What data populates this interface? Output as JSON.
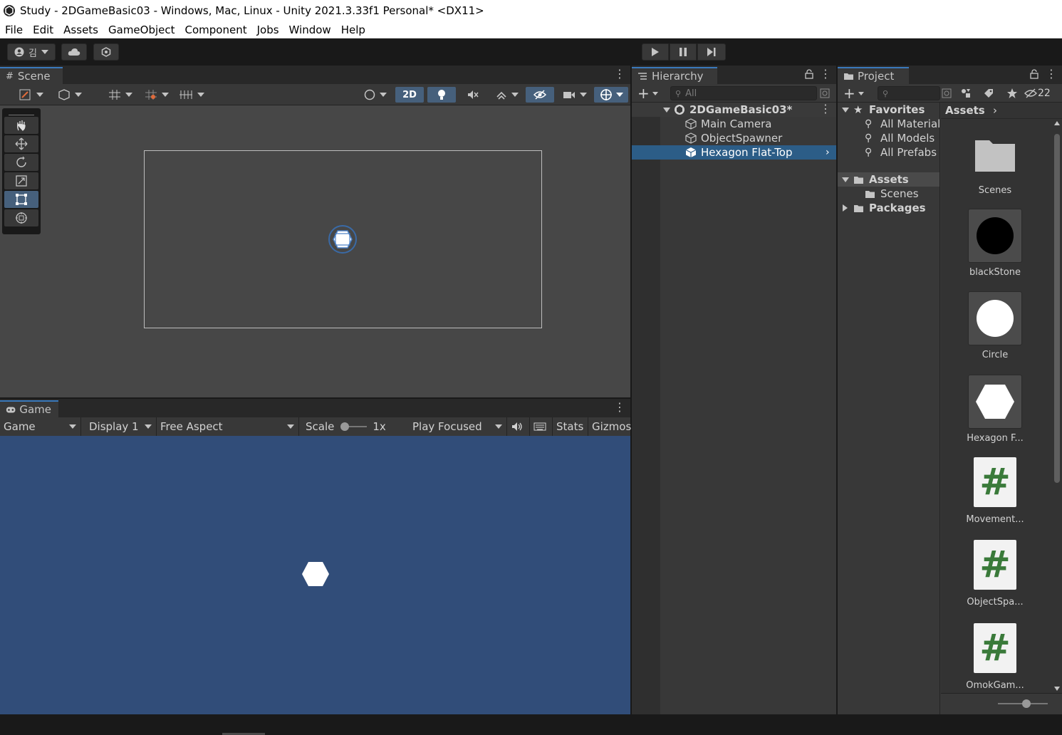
{
  "window": {
    "title": "Study - 2DGameBasic03 - Windows, Mac, Linux - Unity 2021.3.33f1 Personal* <DX11>"
  },
  "menu": [
    "File",
    "Edit",
    "Assets",
    "GameObject",
    "Component",
    "Jobs",
    "Window",
    "Help"
  ],
  "toolbar": {
    "account_label": "김"
  },
  "scene": {
    "tab_label": "Scene",
    "mode_2d_label": "2D"
  },
  "game": {
    "tab_label": "Game",
    "view_select": "Game",
    "display_select": "Display 1",
    "aspect_select": "Free Aspect",
    "scale_label": "Scale",
    "scale_value": "1x",
    "play_mode_select": "Play Focused",
    "stats_label": "Stats",
    "gizmos_label": "Gizmos"
  },
  "hierarchy": {
    "tab_label": "Hierarchy",
    "search_placeholder": "All",
    "scene_name": "2DGameBasic03*",
    "items": [
      "Main Camera",
      "ObjectSpawner",
      "Hexagon Flat-Top"
    ]
  },
  "project": {
    "tab_label": "Project",
    "hidden_count": "22",
    "favorites_label": "Favorites",
    "favorites": [
      "All Materials",
      "All Models",
      "All Prefabs"
    ],
    "assets_label": "Assets",
    "scenes_label": "Scenes",
    "packages_label": "Packages",
    "breadcrumb": "Assets",
    "assets": [
      {
        "name": "Scenes",
        "kind": "folder"
      },
      {
        "name": "blackStone",
        "kind": "sprite-black-circle"
      },
      {
        "name": "Circle",
        "kind": "sprite-white-circle"
      },
      {
        "name": "Hexagon F...",
        "kind": "sprite-hexagon"
      },
      {
        "name": "Movement...",
        "kind": "script"
      },
      {
        "name": "ObjectSpa...",
        "kind": "script"
      },
      {
        "name": "OmokGam...",
        "kind": "script"
      }
    ],
    "script_glyph": "#"
  },
  "colors": {
    "game_background": "#314d79",
    "selection": "#2c5d87",
    "script_green": "#3a7a3a"
  }
}
